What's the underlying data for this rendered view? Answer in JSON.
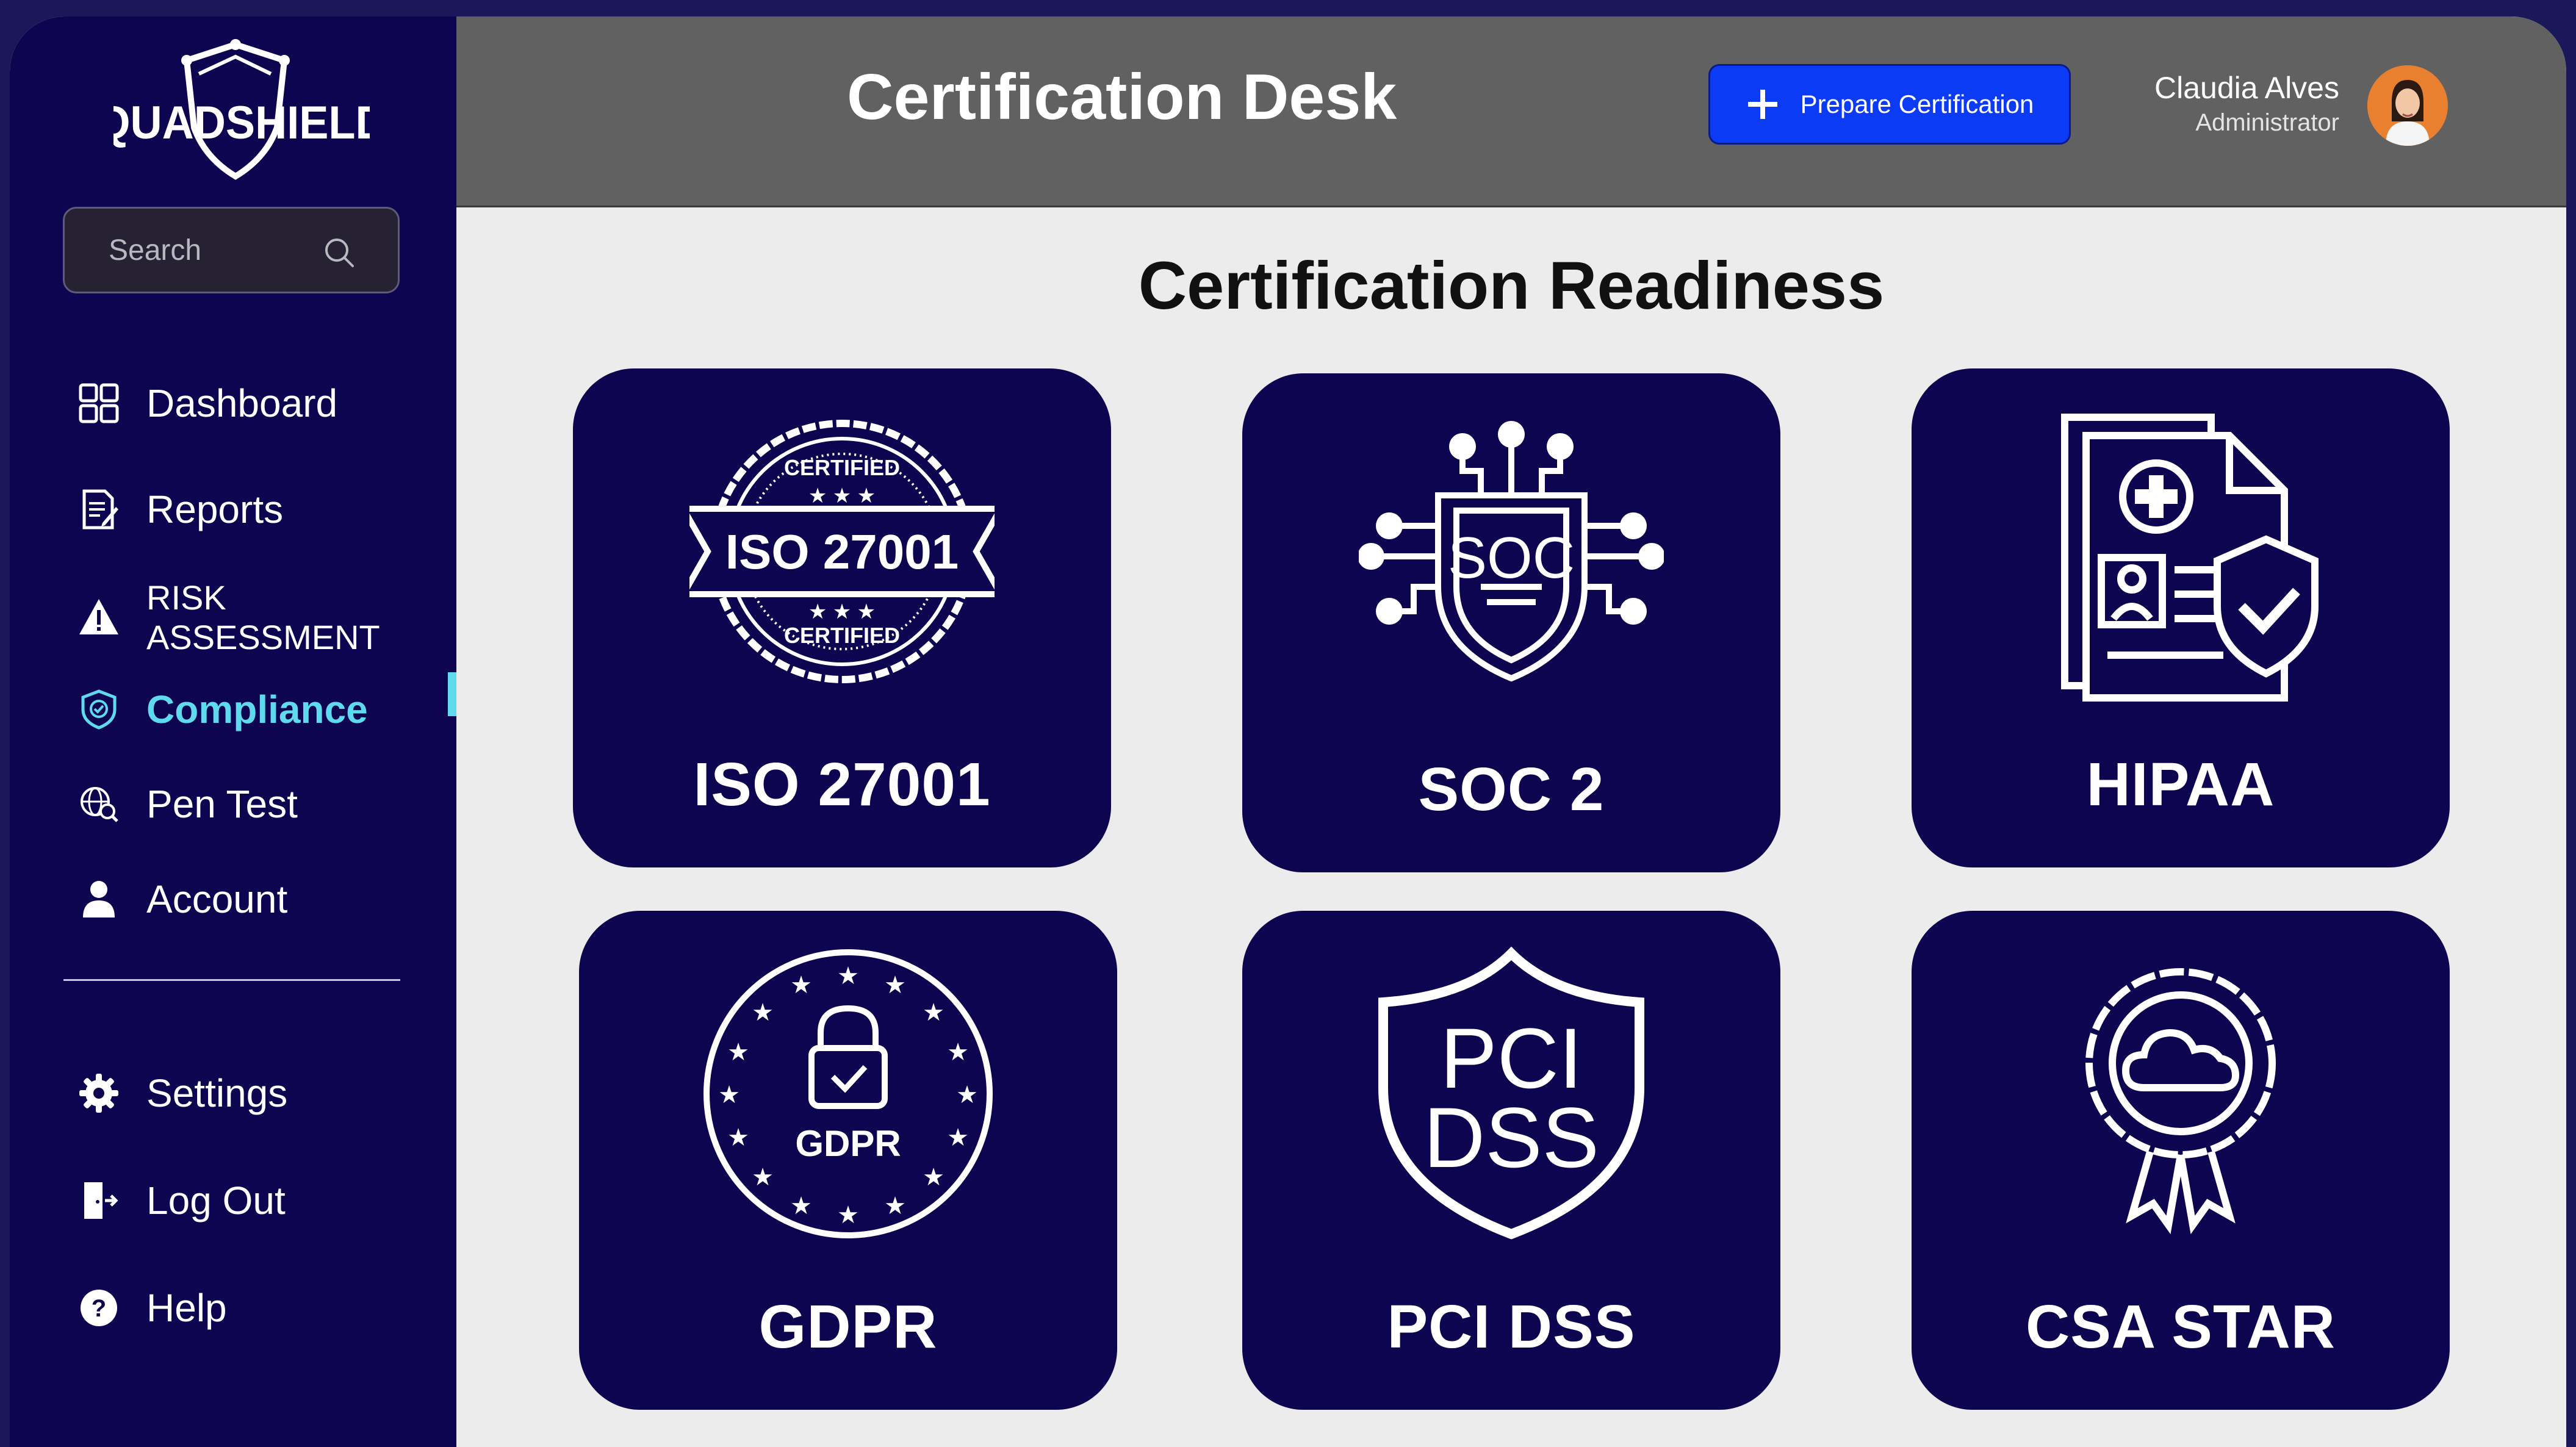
{
  "brand": {
    "logo_text": "QUADSHIELD"
  },
  "search": {
    "placeholder": "Search"
  },
  "sidebar": {
    "items": [
      {
        "label": "Dashboard"
      },
      {
        "label": "Reports"
      },
      {
        "label": "RISK ASSESSMENT"
      },
      {
        "label": "Compliance"
      },
      {
        "label": "Pen Test"
      },
      {
        "label": "Account"
      }
    ],
    "bottom_items": [
      {
        "label": "Settings"
      },
      {
        "label": "Log Out"
      },
      {
        "label": "Help"
      }
    ],
    "active_item": "Compliance"
  },
  "header": {
    "title": "Certification Desk",
    "primary_button": "Prepare Certification",
    "user": {
      "name": "Claudia Alves",
      "role": "Administrator"
    }
  },
  "main": {
    "section_title": "Certification Readiness",
    "cards": [
      {
        "label": "ISO 27001",
        "badge_text": "ISO 27001",
        "seal_text_top": "CERTIFIED",
        "seal_text_bottom": "CERTIFIED"
      },
      {
        "label": "SOC 2",
        "badge_text": "SOC"
      },
      {
        "label": "HIPAA"
      },
      {
        "label": "GDPR",
        "badge_text": "GDPR"
      },
      {
        "label": "PCI DSS",
        "badge_text_1": "PCI",
        "badge_text_2": "DSS"
      },
      {
        "label": "CSA STAR"
      }
    ]
  },
  "colors": {
    "sidebar": "#0e0550",
    "card": "#0e0550",
    "accent": "#5fd9ee",
    "primary_button": "#0b3bf5",
    "topbar": "#616161",
    "content_bg": "#ececec"
  }
}
